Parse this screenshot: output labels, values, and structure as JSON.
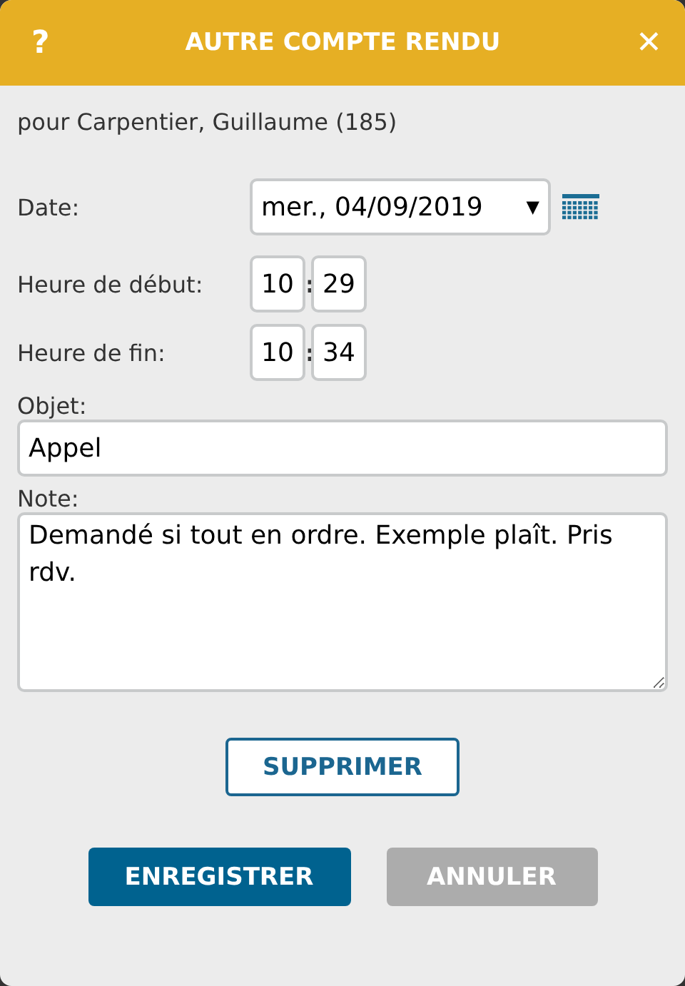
{
  "window": {
    "help": "?",
    "title": "AUTRE COMPTE RENDU",
    "close": "✕"
  },
  "subtitle": "pour Carpentier, Guillaume (185)",
  "date": {
    "label": "Date:",
    "value": "mer., 04/09/2019",
    "caret": "▼"
  },
  "times": [
    {
      "label": "Heure de début:",
      "hours": "10",
      "separator": ":",
      "minutes": "29"
    },
    {
      "label": "Heure de fin:",
      "hours": "10",
      "separator": ":",
      "minutes": "34"
    }
  ],
  "subject": {
    "label": "Objet:",
    "value": "Appel"
  },
  "note": {
    "label": "Note:",
    "value": "Demandé si tout en ordre. Exemple plaît. Pris rdv."
  },
  "buttons": [
    {
      "label": "SUPPRIMER",
      "kind": "outline"
    },
    {
      "label": "ENREGISTRER",
      "kind": "primary"
    },
    {
      "label": "ANNULER",
      "kind": "disabled"
    }
  ]
}
